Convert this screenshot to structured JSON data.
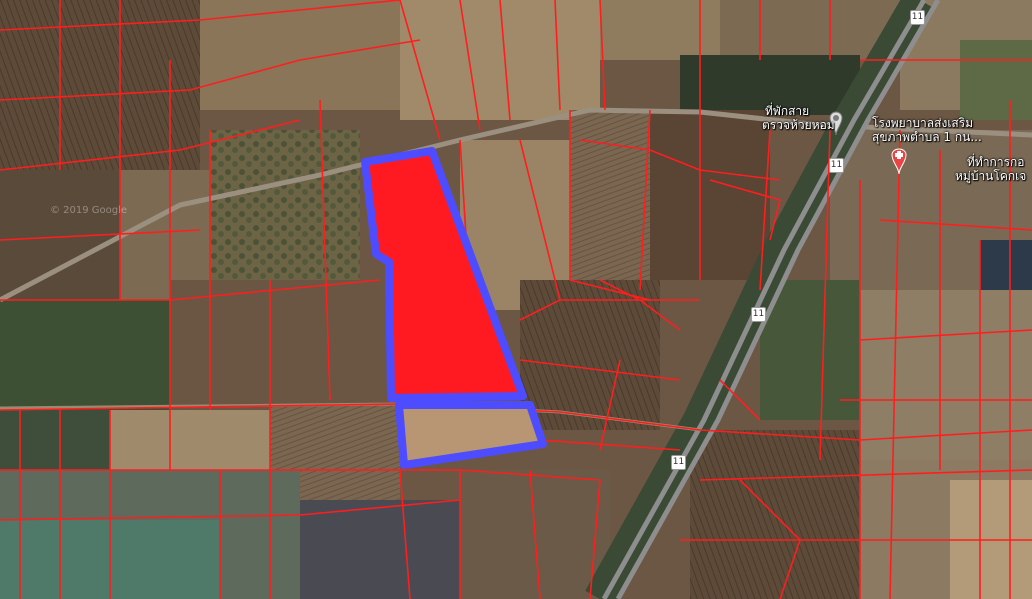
{
  "map": {
    "route_number": "11",
    "labels": {
      "rest_stop_line1": "ที่พักสาย",
      "rest_stop_line2": "ตรวจห้วยหอม",
      "hospital_line1": "โรงพยาบาลส่งเสริม",
      "hospital_line2": "สุขภาพตำบล 1 กน...",
      "village_line1": "ที่ทำการกอ",
      "village_line2": "หมู่บ้านโคกเจ"
    },
    "copyright": "© 2019 Google",
    "colors": {
      "parcel_fill": "#ff1a22",
      "parcel_outline": "#4d4dff",
      "boundary_lines": "#ff1e1e",
      "road": "#8c8c8c",
      "pin": "#e84545"
    },
    "icons": [
      "rest-stop-pin-icon",
      "hospital-pin-icon",
      "route-11-shield-icon"
    ]
  }
}
